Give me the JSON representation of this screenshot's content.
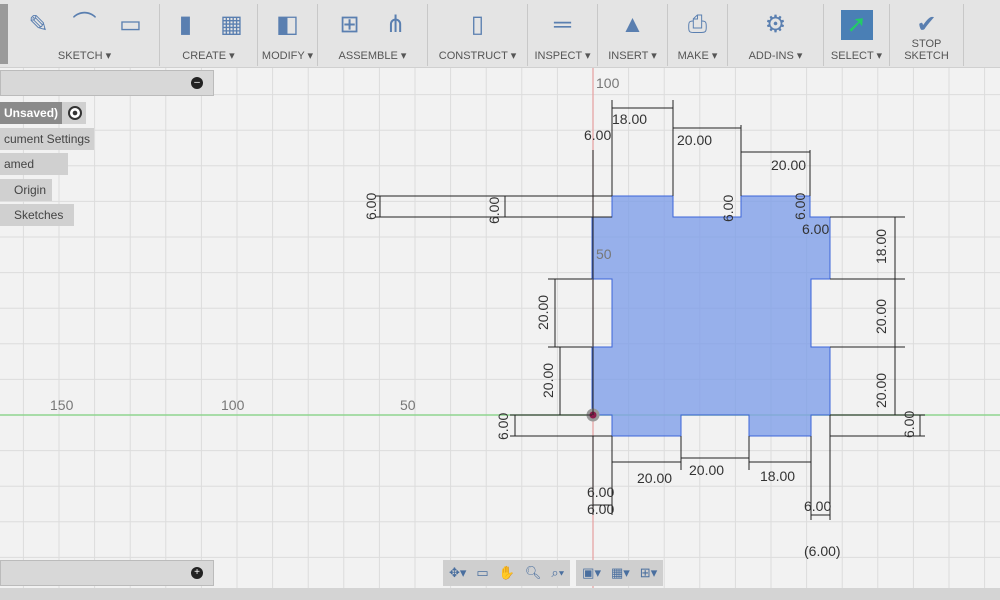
{
  "toolbar": {
    "groups": [
      {
        "label": "SKETCH ▾",
        "icons": [
          "create-sketch-icon",
          "spline-icon",
          "rectangle-icon"
        ]
      },
      {
        "label": "CREATE ▾",
        "icons": [
          "extrude-icon",
          "form-icon"
        ]
      },
      {
        "label": "MODIFY ▾",
        "icons": [
          "press-pull-icon"
        ]
      },
      {
        "label": "ASSEMBLE ▾",
        "icons": [
          "new-component-icon",
          "joint-icon"
        ]
      },
      {
        "label": "CONSTRUCT ▾",
        "icons": [
          "offset-plane-icon"
        ]
      },
      {
        "label": "INSPECT ▾",
        "icons": [
          "measure-icon"
        ]
      },
      {
        "label": "INSERT ▾",
        "icons": [
          "insert-image-icon"
        ]
      },
      {
        "label": "MAKE ▾",
        "icons": [
          "3d-print-icon"
        ]
      },
      {
        "label": "ADD-INS ▾",
        "icons": [
          "scripts-icon"
        ]
      },
      {
        "label": "SELECT ▾",
        "icons": [
          "select-icon"
        ]
      },
      {
        "label": "STOP SKETCH",
        "icons": [
          "stop-sketch-icon"
        ]
      }
    ]
  },
  "browser": {
    "doc": "Unsaved)",
    "items": [
      "cument Settings",
      "amed Views",
      "Origin",
      "Sketches"
    ]
  },
  "axis_labels": {
    "x150": "150",
    "x100": "100",
    "x50": "50",
    "y100": "100",
    "y50": "50"
  },
  "dims": {
    "d1": "18.00",
    "d2": "20.00",
    "d3": "20.00",
    "d4": "6.00",
    "d5": "6.00",
    "d6": "6.00",
    "d7": "6.00",
    "d8": "6.00",
    "d9": "6.00",
    "d10": "18.00",
    "d11": "20.00",
    "d12": "20.00",
    "d13": "6.00",
    "d14": "20.00",
    "d15": "20.00",
    "d16": "6.00",
    "d17": "20.00",
    "d18": "20.00",
    "d19": "18.00",
    "d20": "6.00",
    "d21": "6.00",
    "d22": "6.00",
    "d23": "(6.00)"
  },
  "colors": {
    "profile": "#7f9fe8",
    "accent": "#4a7fb5",
    "x_axis": "#7fcf7f",
    "y_axis": "#e08080"
  },
  "navbar": [
    "orbit-icon",
    "look-at-icon",
    "pan-icon",
    "zoom-icon",
    "fit-icon",
    "display-settings-icon",
    "grid-settings-icon",
    "viewports-icon"
  ]
}
